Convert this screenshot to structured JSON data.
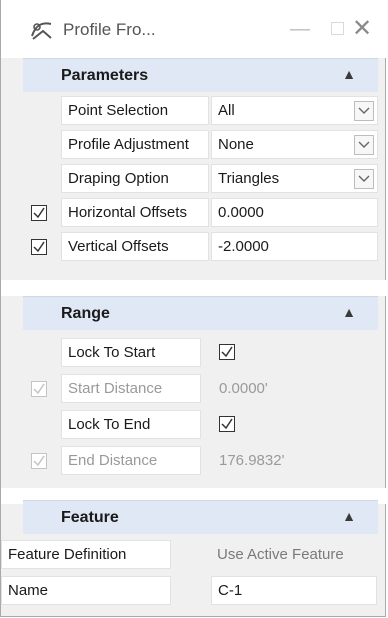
{
  "window": {
    "title": "Profile Fro..."
  },
  "parameters": {
    "header": "Parameters",
    "rows": [
      {
        "label": "Point Selection",
        "value": "All"
      },
      {
        "label": "Profile Adjustment",
        "value": "None"
      },
      {
        "label": "Draping Option",
        "value": "Triangles"
      },
      {
        "label": "Horizontal Offsets",
        "value": "0.0000",
        "checked": true
      },
      {
        "label": "Vertical Offsets",
        "value": "-2.0000",
        "checked": true
      }
    ]
  },
  "range": {
    "header": "Range",
    "rows": [
      {
        "label": "Lock To Start",
        "checked": true
      },
      {
        "label": "Start Distance",
        "value": "0.0000'",
        "checked": true,
        "disabled": true
      },
      {
        "label": "Lock To End",
        "checked": true
      },
      {
        "label": "End Distance",
        "value": "176.9832'",
        "checked": true,
        "disabled": true
      }
    ]
  },
  "feature": {
    "header": "Feature",
    "rows": [
      {
        "label": "Feature Definition",
        "value": "Use Active Feature"
      },
      {
        "label": "Name",
        "value": "C-1"
      }
    ]
  },
  "colors": {
    "header_bg": "#dfe8f4",
    "panel_bg": "#f0f0f0"
  }
}
